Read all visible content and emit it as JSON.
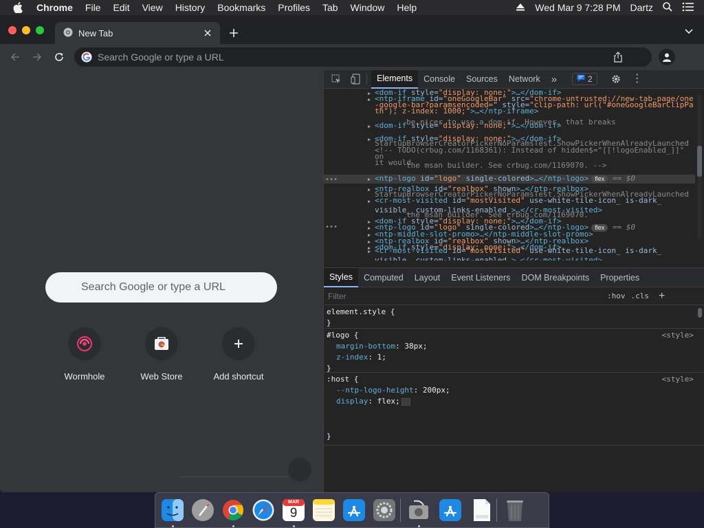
{
  "menubar": {
    "app": "Chrome",
    "items": [
      "File",
      "Edit",
      "View",
      "History",
      "Bookmarks",
      "Profiles",
      "Tab",
      "Window",
      "Help"
    ],
    "datetime": "Wed Mar 9  7:28 PM",
    "user": "Dartz"
  },
  "browser": {
    "tab_title": "New Tab",
    "omnibox_placeholder": "Search Google or type a URL"
  },
  "ntp": {
    "search_placeholder": "Search Google or type a URL",
    "shortcuts": [
      {
        "label": "Wormhole",
        "icon": "wormhole-icon"
      },
      {
        "label": "Web Store",
        "icon": "web-store-icon"
      },
      {
        "label": "Add shortcut",
        "icon": "plus-icon"
      }
    ]
  },
  "devtools": {
    "tabs": [
      "Elements",
      "Console",
      "Sources",
      "Network"
    ],
    "active_tab": "Elements",
    "more_tabs": "»",
    "issues_count": "2",
    "subtabs": [
      "Styles",
      "Computed",
      "Layout",
      "Event Listeners",
      "DOM Breakpoints",
      "Properties"
    ],
    "active_subtab": "Styles",
    "filter_placeholder": "Filter",
    "hov": ":hov",
    "cls": ".cls",
    "dom_rows": [
      {
        "t1": "<dom-if",
        "a1": " style=",
        "v1": "\"display: none;\"",
        "t2": ">…</dom-if>"
      },
      {
        "t1": "<ntp-iframe",
        "a1": " id=",
        "v1": "\"oneGoogleBar\"",
        "a2": " src=",
        "v2": "\"chrome-untrusted://new-tab-page/one"
      },
      {
        "v1": "-google-bar?paramsencoded=",
        "a1": "\" style=",
        "v2": "\"clip-path: url(\"#oneGoogleBarClipPa"
      },
      {
        "v1": "th\"); z-index: 1000;\"",
        "t1": ">…</ntp-iframe>"
      },
      {
        "t1": "<dom-if",
        "a1": " style=",
        "v1": "\"display: none;\"",
        "t2": ">…</dom-if>"
      },
      {
        "c1": "be nicer to use a dom-if. However, that breaks"
      },
      {
        "t1": "<dom-if",
        "a1": " style=",
        "v1": "\"display: none;\"",
        "t2": ">…</dom-if>"
      },
      {
        "c1": "StartupBrowserCreatorPickerNoParamsTest.ShowPickerWhenAlreadyLaunched"
      },
      {
        "c1": "<!-- TODO(crbug.com/1168361): Instead of hidden$=\"[[!logoEnabled_]]\""
      },
      {
        "c1": "on"
      },
      {
        "c1": "it would"
      },
      {
        "c1": "      the msan builder. See crbug.com/1169070. -->"
      },
      {
        "t1": "<ntp-logo",
        "a1": " id=",
        "v1": "\"logo\"",
        "a2": " single-colored",
        "t2": ">…</ntp-logo>",
        "badge": "flex",
        "dollar": "== $0"
      },
      {
        "t1": "<ntp-realbox",
        "a1": " id=",
        "v1": "\"realbox\"",
        "a2": " shown",
        "t2": ">…</ntp-realbox>"
      },
      {
        "c1": "StartupBrowserCreatorPickerNoParamsTest.ShowPickerWhenAlreadyLaunched"
      },
      {
        "t1": "<cr-most-visited",
        "a1": " id=",
        "v1": "\"mostVisited\"",
        "a2": " use-white-tile-icon_ is-dark_"
      },
      {
        "a1": "visible_ custom-links-enabled_",
        "t1": ">…</cr-most-visited>"
      },
      {
        "c1": "      the msan builder. See crbug.com/1169070."
      },
      {
        "t1": "<dom-if",
        "a1": " style=",
        "v1": "\"display: none;\"",
        "t2": ">…</dom-if>"
      },
      {
        "t1": "<ntp-logo",
        "a1": " id=",
        "v1": "\"logo\"",
        "a2": " single-colored",
        "t2": ">…</ntp-logo>",
        "badge": "flex",
        "dollar": "== $0"
      },
      {
        "t1": "<ntp-middle-slot-promo",
        "t2": ">…</ntp-middle-slot-promo>"
      },
      {
        "t1": "<ntp-realbox",
        "a1": " id=",
        "v1": "\"realbox\"",
        "a2": " shown",
        "t2": ">…</ntp-realbox>"
      },
      {
        "t1": "<dom-if",
        "a1": " style=",
        "v1": "\"display: none;\"",
        "t2": ">…</dom-if>"
      },
      {
        "t1": "<cr-most-visited",
        "a1": " id=",
        "v1": "\"mostVisited\"",
        "a2": " use-white-tile-icon_ is-dark_"
      },
      {
        "a1": "visible_ custom-links-enabled_",
        "t1": ">…</cr-most-visited>"
      }
    ],
    "rules": [
      {
        "selector": "element.style {",
        "close": "}",
        "source": "",
        "props": []
      },
      {
        "selector": "#logo {",
        "close": "}",
        "source": "<style>",
        "props": [
          {
            "name": "margin-bottom",
            "value": "38px;"
          },
          {
            "name": "z-index",
            "value": "1;"
          }
        ]
      },
      {
        "selector": ":host {",
        "close": "}",
        "source": "<style>",
        "props": [
          {
            "name": "--ntp-logo-height",
            "value": "200px;"
          },
          {
            "name": "display",
            "value": "flex;"
          }
        ]
      }
    ]
  },
  "dock": {
    "apps": [
      "finder-icon",
      "launchpad-icon",
      "chrome-icon",
      "safari-icon",
      "calendar-icon",
      "notes-icon",
      "app-store-icon",
      "system-preferences-icon",
      "disk-utility-icon",
      "app-store-downloads-icon",
      "html-file-icon",
      "trash-icon"
    ],
    "calendar_month": "MAR",
    "calendar_day": "9"
  }
}
